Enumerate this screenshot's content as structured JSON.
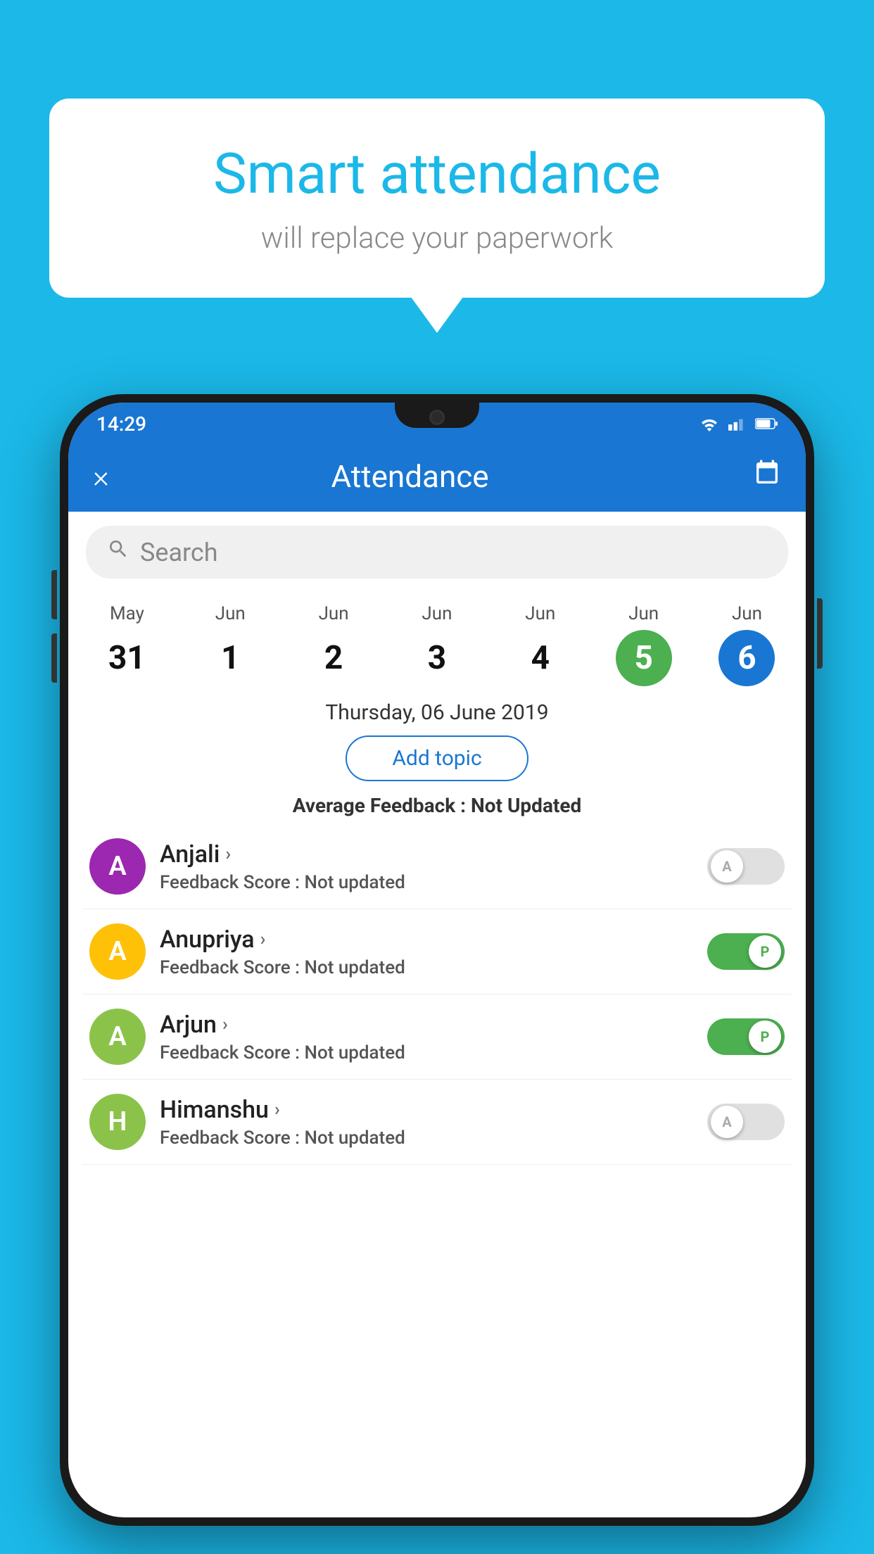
{
  "background_color": "#1BB8E8",
  "bubble": {
    "title": "Smart attendance",
    "subtitle": "will replace your paperwork"
  },
  "status_bar": {
    "time": "14:29"
  },
  "app_bar": {
    "title": "Attendance",
    "close_icon": "×",
    "calendar_icon": "📅"
  },
  "search": {
    "placeholder": "Search"
  },
  "calendar": {
    "days": [
      {
        "month": "May",
        "date": "31",
        "state": "normal"
      },
      {
        "month": "Jun",
        "date": "1",
        "state": "normal"
      },
      {
        "month": "Jun",
        "date": "2",
        "state": "normal"
      },
      {
        "month": "Jun",
        "date": "3",
        "state": "normal"
      },
      {
        "month": "Jun",
        "date": "4",
        "state": "normal"
      },
      {
        "month": "Jun",
        "date": "5",
        "state": "today"
      },
      {
        "month": "Jun",
        "date": "6",
        "state": "selected"
      }
    ]
  },
  "selected_date": "Thursday, 06 June 2019",
  "add_topic_label": "Add topic",
  "avg_feedback_label": "Average Feedback :",
  "avg_feedback_value": "Not Updated",
  "students": [
    {
      "name": "Anjali",
      "initial": "A",
      "avatar_color": "#9C27B0",
      "feedback_label": "Feedback Score :",
      "feedback_value": "Not updated",
      "attendance": "A",
      "present": false
    },
    {
      "name": "Anupriya",
      "initial": "A",
      "avatar_color": "#FFC107",
      "feedback_label": "Feedback Score :",
      "feedback_value": "Not updated",
      "attendance": "P",
      "present": true
    },
    {
      "name": "Arjun",
      "initial": "A",
      "avatar_color": "#8BC34A",
      "feedback_label": "Feedback Score :",
      "feedback_value": "Not updated",
      "attendance": "P",
      "present": true
    },
    {
      "name": "Himanshu",
      "initial": "H",
      "avatar_color": "#8BC34A",
      "feedback_label": "Feedback Score :",
      "feedback_value": "Not updated",
      "attendance": "A",
      "present": false
    }
  ]
}
